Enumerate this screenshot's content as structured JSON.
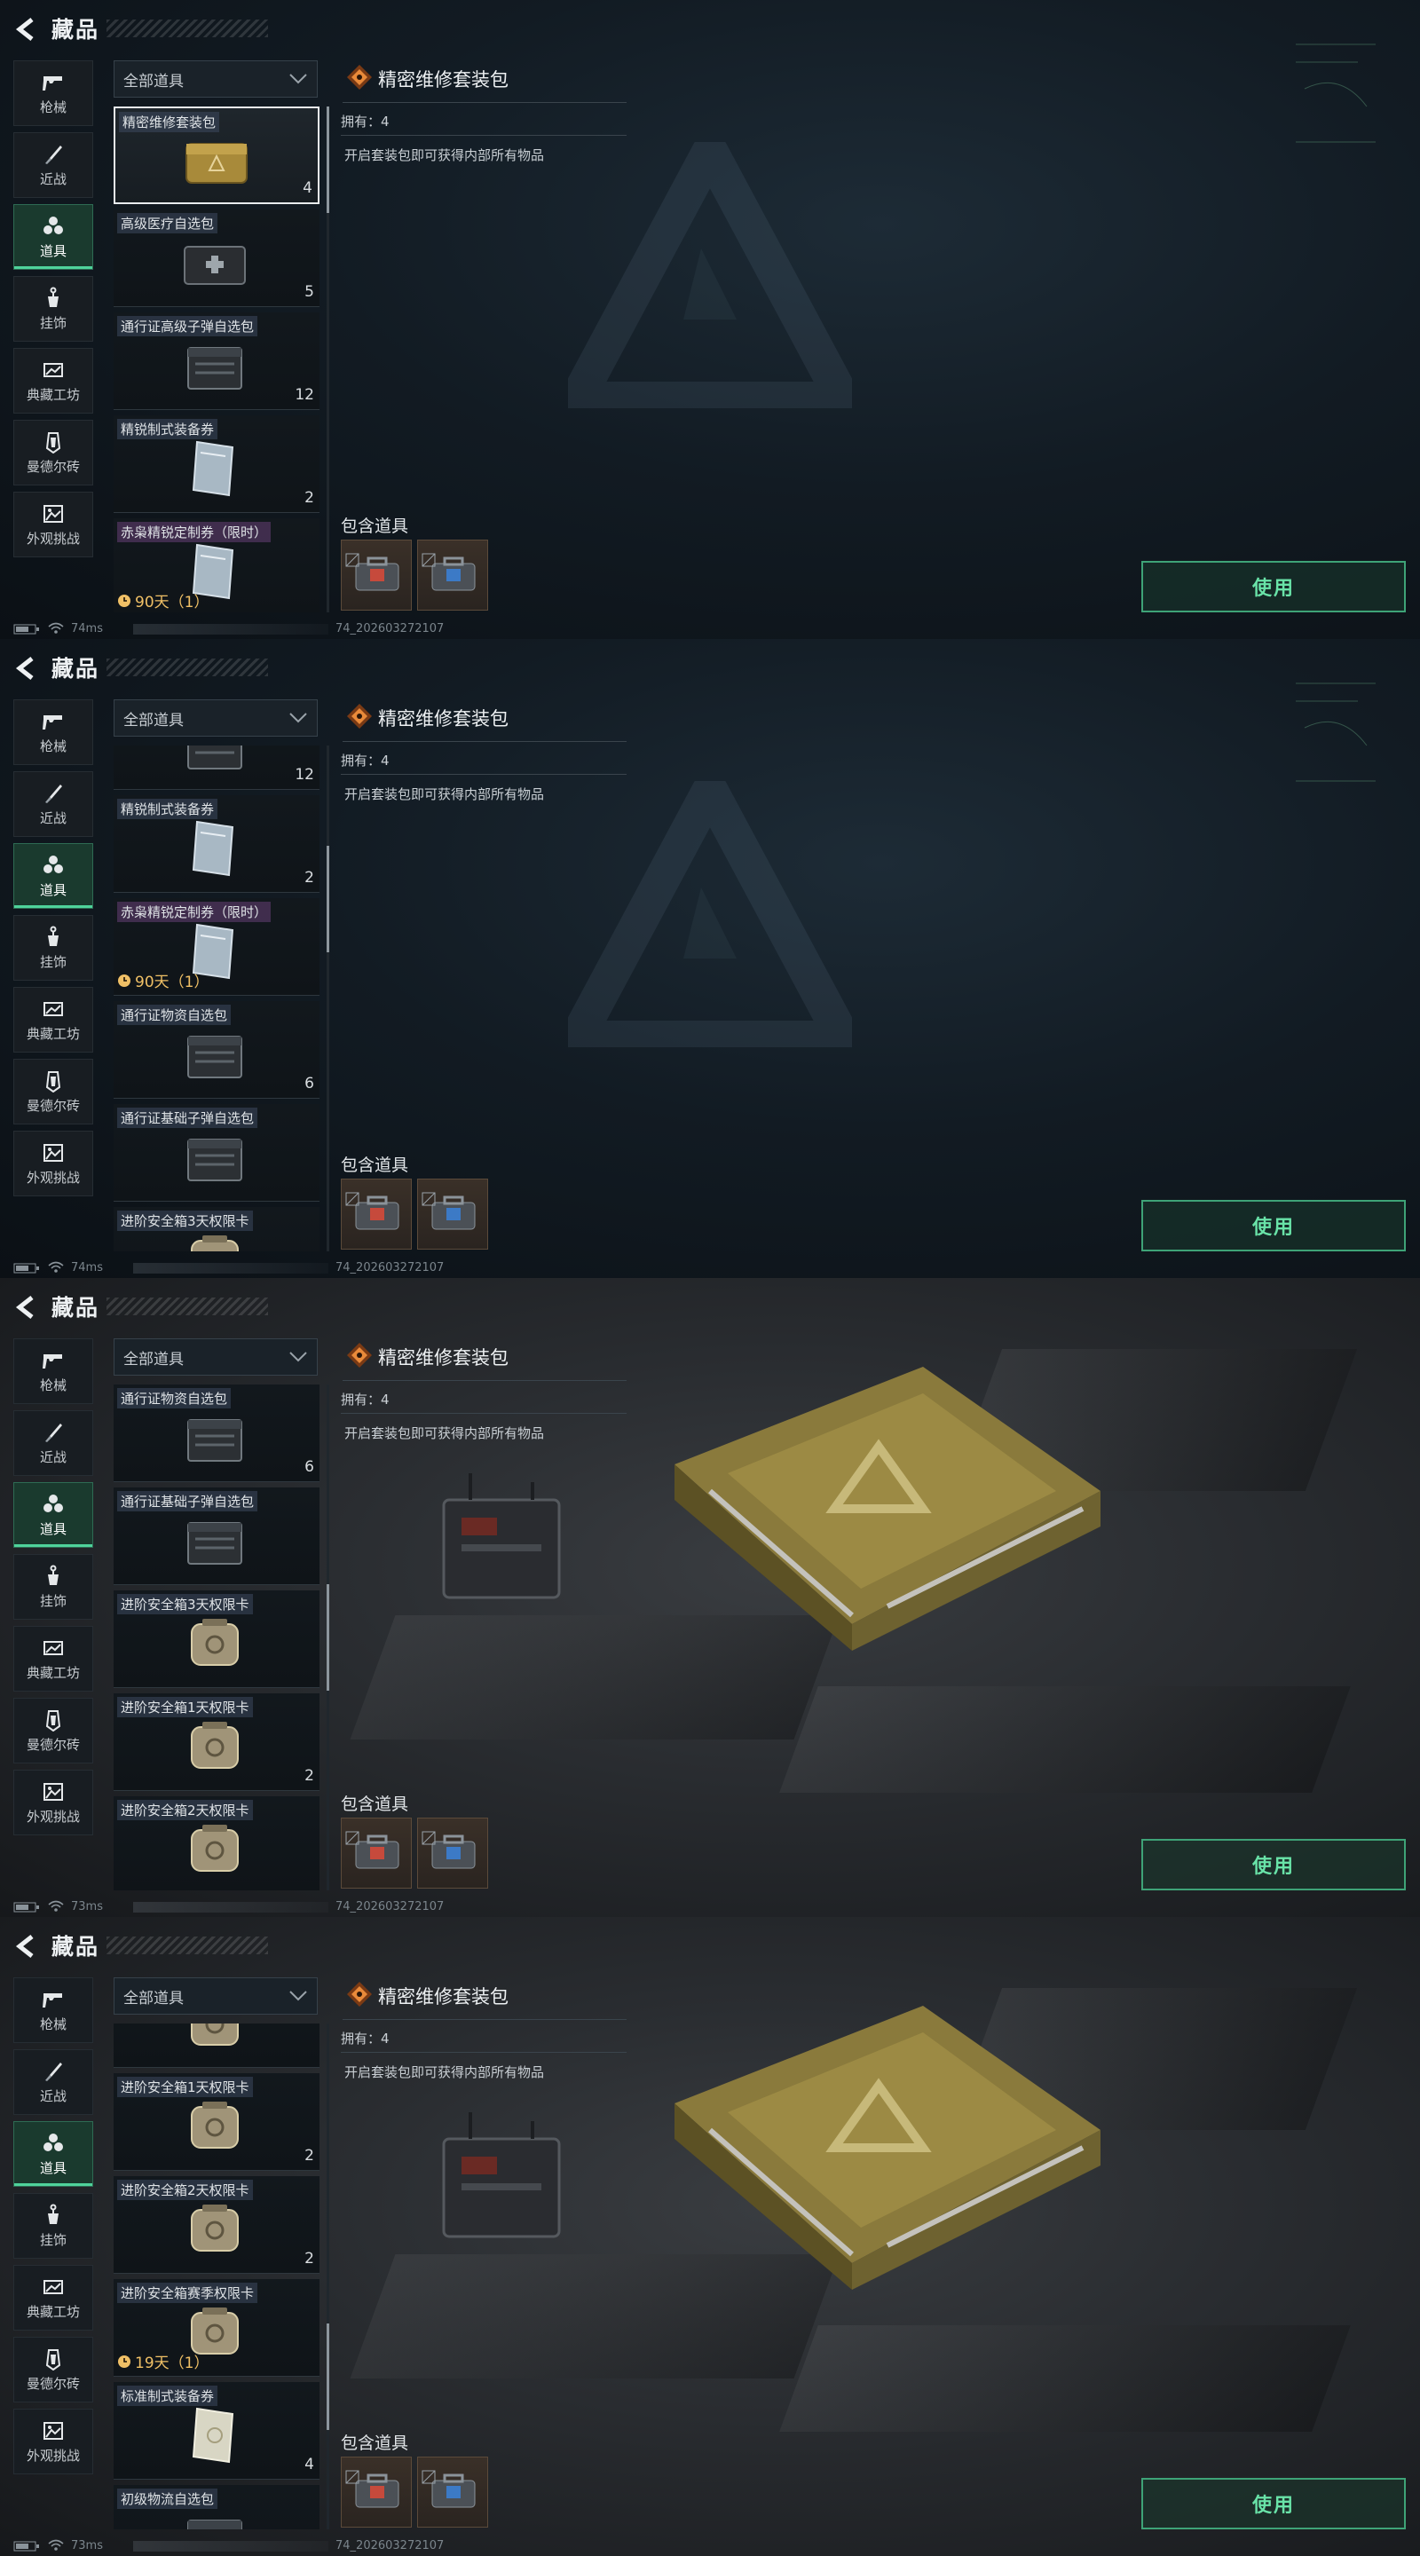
{
  "header": {
    "title": "藏品"
  },
  "sidebar": [
    {
      "label": "枪械",
      "icon": "gun-icon",
      "active": false
    },
    {
      "label": "近战",
      "icon": "knife-icon",
      "active": false
    },
    {
      "label": "道具",
      "icon": "items-icon",
      "active": true
    },
    {
      "label": "挂饰",
      "icon": "charm-icon",
      "active": false
    },
    {
      "label": "典藏工坊",
      "icon": "workshop-icon",
      "active": false
    },
    {
      "label": "曼德尔砖",
      "icon": "mandel-brick-icon",
      "active": false
    },
    {
      "label": "外观挑战",
      "icon": "image-icon",
      "active": false
    }
  ],
  "filter": {
    "label": "全部道具"
  },
  "detail": {
    "name": "精密维修套装包",
    "owned": "拥有：4",
    "description": "开启套装包即可获得内部所有物品",
    "contains_label": "包含道具",
    "use_label": "使用"
  },
  "status_bar": {
    "ping": [
      "74ms",
      "74ms",
      "73ms",
      "73ms"
    ],
    "session_id": "74_202603272107"
  },
  "panels": [
    {
      "background": "dark",
      "scroll_fraction": 0.0,
      "items": [
        {
          "name": "精密维修套装包",
          "count": "4",
          "timer": "",
          "kind": "gold-box",
          "selected": true,
          "tag": "blue"
        },
        {
          "name": "高级医疗自选包",
          "count": "5",
          "timer": "",
          "kind": "medkit",
          "selected": false,
          "tag": "blue"
        },
        {
          "name": "通行证高级子弹自选包",
          "count": "12",
          "timer": "",
          "kind": "ammo-box",
          "selected": false,
          "tag": "blue"
        },
        {
          "name": "精锐制式装备券",
          "count": "2",
          "timer": "",
          "kind": "ticket",
          "selected": false,
          "tag": "blue"
        },
        {
          "name": "赤枭精锐定制券（限时）",
          "count": "",
          "timer": "90天（1）",
          "kind": "ticket",
          "selected": false,
          "tag": "purple"
        }
      ]
    },
    {
      "background": "dark",
      "scroll_fraction": 0.25,
      "items": [
        {
          "name": "",
          "count": "12",
          "timer": "",
          "kind": "ammo-box",
          "selected": false,
          "tag": "blue",
          "partial": true
        },
        {
          "name": "精锐制式装备券",
          "count": "2",
          "timer": "",
          "kind": "ticket",
          "selected": false,
          "tag": "blue"
        },
        {
          "name": "赤枭精锐定制券（限时）",
          "count": "",
          "timer": "90天（1）",
          "kind": "ticket",
          "selected": false,
          "tag": "purple"
        },
        {
          "name": "通行证物资自选包",
          "count": "6",
          "timer": "",
          "kind": "ammo-box",
          "selected": false,
          "tag": "blue"
        },
        {
          "name": "通行证基础子弹自选包",
          "count": "",
          "timer": "",
          "kind": "ammo-box",
          "selected": false,
          "tag": "blue"
        },
        {
          "name": "进阶安全箱3天权限卡",
          "count": "",
          "timer": "",
          "kind": "safe-card",
          "selected": false,
          "tag": "blue"
        }
      ]
    },
    {
      "background": "photo",
      "scroll_fraction": 0.5,
      "items": [
        {
          "name": "通行证物资自选包",
          "count": "6",
          "timer": "",
          "kind": "ammo-box",
          "selected": false,
          "tag": "blue"
        },
        {
          "name": "通行证基础子弹自选包",
          "count": "",
          "timer": "",
          "kind": "ammo-box",
          "selected": false,
          "tag": "blue"
        },
        {
          "name": "进阶安全箱3天权限卡",
          "count": "",
          "timer": "",
          "kind": "safe-card",
          "selected": false,
          "tag": "blue"
        },
        {
          "name": "进阶安全箱1天权限卡",
          "count": "2",
          "timer": "",
          "kind": "safe-card",
          "selected": false,
          "tag": "blue"
        },
        {
          "name": "进阶安全箱2天权限卡",
          "count": "",
          "timer": "",
          "kind": "safe-card",
          "selected": false,
          "tag": "blue"
        }
      ]
    },
    {
      "background": "photo",
      "scroll_fraction": 0.75,
      "items": [
        {
          "name": "",
          "count": "",
          "timer": "",
          "kind": "safe-card",
          "selected": false,
          "tag": "blue",
          "partial": true
        },
        {
          "name": "进阶安全箱1天权限卡",
          "count": "2",
          "timer": "",
          "kind": "safe-card",
          "selected": false,
          "tag": "blue"
        },
        {
          "name": "进阶安全箱2天权限卡",
          "count": "2",
          "timer": "",
          "kind": "safe-card",
          "selected": false,
          "tag": "blue"
        },
        {
          "name": "进阶安全箱赛季权限卡",
          "count": "",
          "timer": "19天（1）",
          "kind": "safe-card",
          "selected": false,
          "tag": "blue"
        },
        {
          "name": "标准制式装备券",
          "count": "4",
          "timer": "",
          "kind": "ticket-white",
          "selected": false,
          "tag": "blue"
        },
        {
          "name": "初级物流自选包",
          "count": "",
          "timer": "",
          "kind": "ammo-box",
          "selected": false,
          "tag": "blue"
        }
      ]
    }
  ]
}
